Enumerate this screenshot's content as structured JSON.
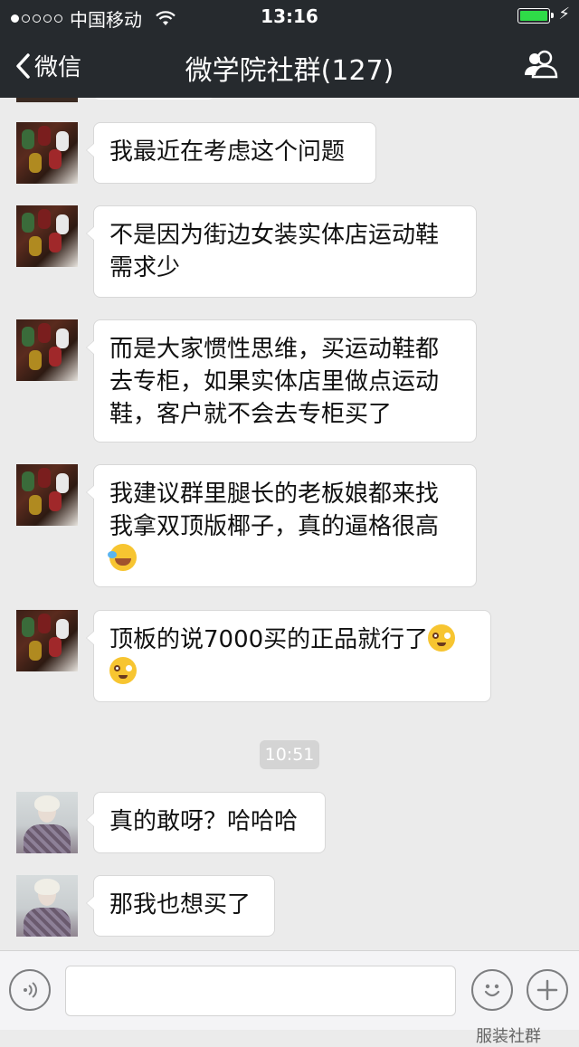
{
  "status_bar": {
    "carrier": "中国移动",
    "time": "13:16"
  },
  "nav": {
    "back_label": "微信",
    "title": "微学院社群(127)"
  },
  "messages": [
    {
      "text": "我最近在考虑这个问题"
    },
    {
      "text_lines": [
        "不是因为街边女装实体店运动鞋",
        "需求少"
      ]
    },
    {
      "text_lines": [
        "而是大家惯性思维，买运动鞋都",
        "去专柜，如果实体店里做点运动",
        "鞋，客户就不会去专柜买了"
      ]
    },
    {
      "text_lines": [
        "我建议群里腿长的老板娘都来找",
        "我拿双顶版椰子，真的逼格很高"
      ],
      "emoji_line": "face-with-tears-of-joy"
    },
    {
      "text": "顶板的说7000买的正品就行了",
      "emoji_line": "flushed-face"
    },
    {
      "text": "真的敢呀？哈哈哈"
    },
    {
      "text": "那我也想买了"
    }
  ],
  "timestamp": "10:51",
  "watermark": "服装社群",
  "icons": {
    "back": "chevron-left-icon",
    "group": "group-members-icon",
    "voice": "voice-icon",
    "emoji": "emoji-icon",
    "plus": "plus-icon"
  }
}
